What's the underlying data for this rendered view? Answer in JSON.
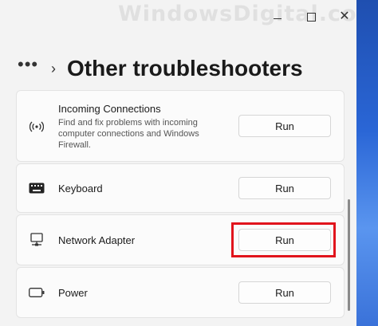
{
  "watermark": "WindowsDigital.com",
  "window": {
    "minimize_icon": "minimize-icon",
    "maximize_icon": "maximize-icon",
    "close_icon": "close-icon"
  },
  "header": {
    "more_label": "•••",
    "title": "Other troubleshooters"
  },
  "items": [
    {
      "label": "Incoming Connections",
      "description": "Find and fix problems with incoming computer connections and Windows Firewall.",
      "icon": "wifi-signal-icon",
      "button": "Run"
    },
    {
      "label": "Keyboard",
      "icon": "keyboard-icon",
      "button": "Run"
    },
    {
      "label": "Network Adapter",
      "icon": "network-adapter-icon",
      "button": "Run",
      "highlighted": true
    },
    {
      "label": "Power",
      "icon": "battery-icon",
      "button": "Run"
    }
  ],
  "colors": {
    "highlight": "#e1141c",
    "background": "#f3f3f3",
    "card": "#fbfbfb"
  }
}
